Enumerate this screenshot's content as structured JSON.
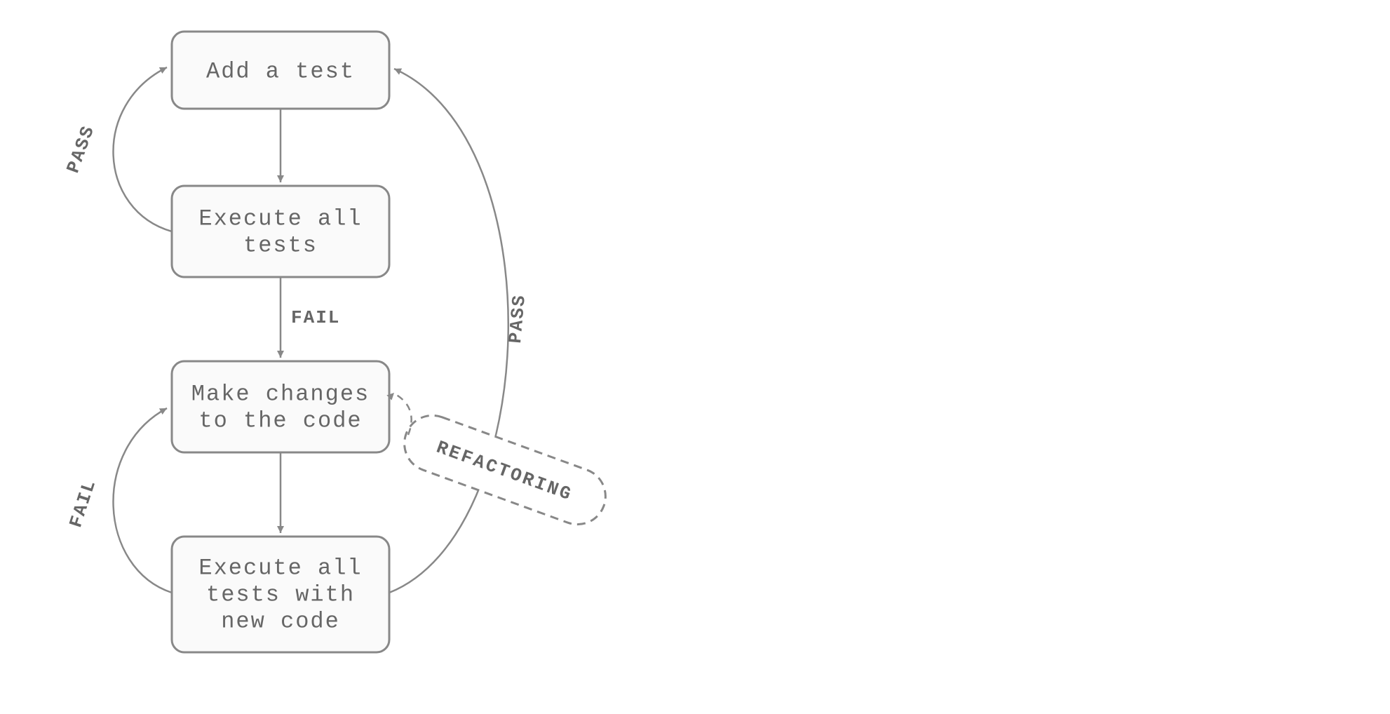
{
  "diagram": {
    "nodes": {
      "n1": {
        "label": "Add a test"
      },
      "n2": {
        "line1": "Execute all",
        "line2": "tests"
      },
      "n3": {
        "line1": "Make changes",
        "line2": "to the code"
      },
      "n4": {
        "line1": "Execute all",
        "line2": "tests with",
        "line3": "new code"
      },
      "refactor": {
        "label": "REFACTORING"
      }
    },
    "edges": {
      "pass_top": "PASS",
      "fail_mid": "FAIL",
      "fail_bottom": "FAIL",
      "pass_right": "PASS"
    }
  }
}
